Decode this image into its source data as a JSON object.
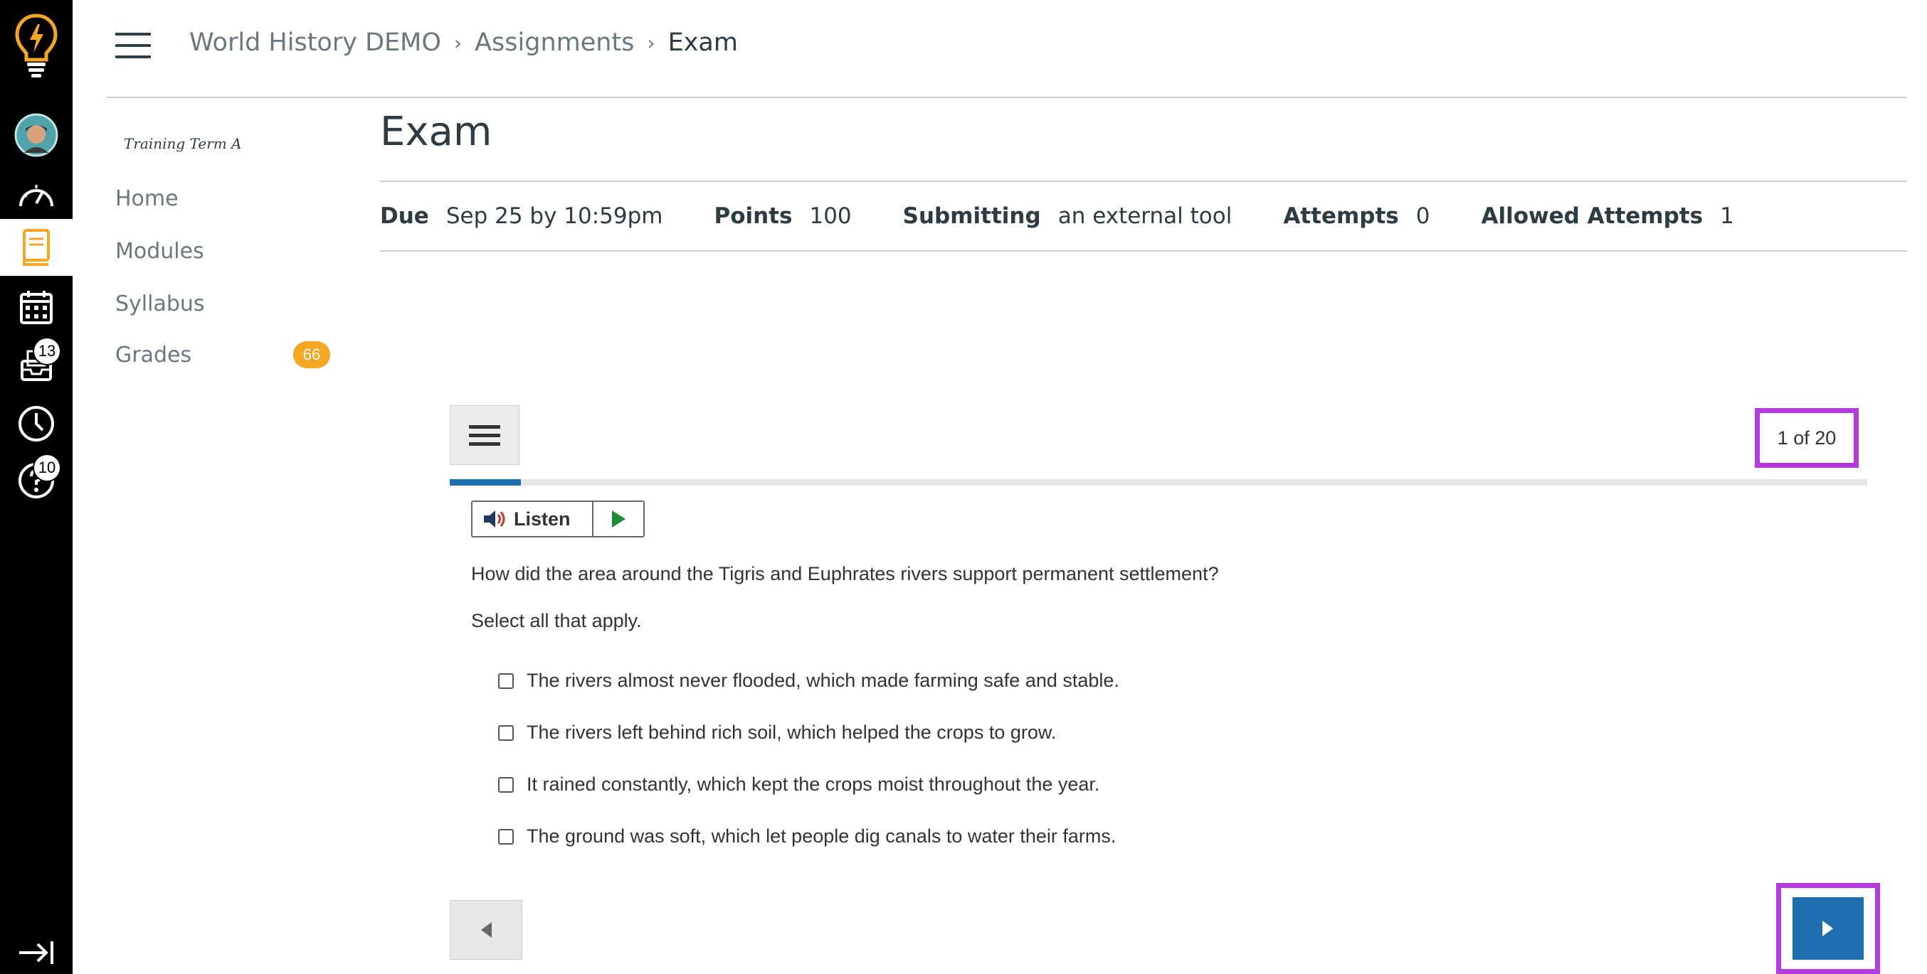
{
  "global_nav": {
    "active": "courses",
    "items": [
      {
        "name": "logo-icon"
      },
      {
        "name": "account-avatar"
      },
      {
        "name": "dashboard-icon"
      },
      {
        "name": "courses-icon"
      },
      {
        "name": "calendar-icon"
      },
      {
        "name": "inbox-icon",
        "badge": "13"
      },
      {
        "name": "history-icon"
      },
      {
        "name": "help-icon",
        "badge": "10"
      },
      {
        "name": "collapse-nav-icon"
      }
    ],
    "colors": {
      "background": "#000000",
      "accent": "#f5a623"
    }
  },
  "breadcrumb": {
    "course": "World History DEMO",
    "section": "Assignments",
    "current": "Exam",
    "separator": "›"
  },
  "course_nav": {
    "term": "Training Term A",
    "items": [
      {
        "label": "Home"
      },
      {
        "label": "Modules"
      },
      {
        "label": "Syllabus"
      },
      {
        "label": "Grades",
        "badge": "66"
      }
    ]
  },
  "assignment": {
    "title": "Exam",
    "details": {
      "due_label": "Due",
      "due_value": "Sep 25 by 10:59pm",
      "points_label": "Points",
      "points_value": "100",
      "submitting_label": "Submitting",
      "submitting_value": "an external tool",
      "attempts_label": "Attempts",
      "attempts_value": "0",
      "allowed_label": "Allowed Attempts",
      "allowed_value": "1"
    }
  },
  "quiz": {
    "counter": "1 of 20",
    "progress_fraction": 0.05,
    "listen_label": "Listen",
    "question": "How did the area around the Tigris and Euphrates rivers support permanent settlement?",
    "instruction": "Select all that apply.",
    "options": [
      "The rivers almost never flooded, which made farming safe and stable.",
      "The rivers left behind rich soil, which helped the crops to grow.",
      "It rained constantly, which kept the crops moist throughout the year.",
      "The ground was soft, which let people dig canals to water their farms."
    ],
    "highlight_color": "#b43be0",
    "primary_color": "#1f6fb0"
  }
}
